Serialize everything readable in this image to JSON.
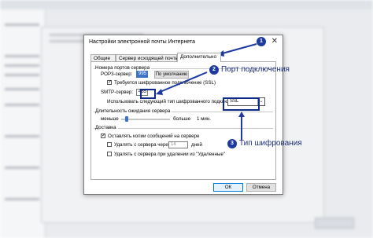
{
  "dialog": {
    "title": "Настройки электронной почты Интернета",
    "close_glyph": "✕",
    "tabs": [
      {
        "label": "Общие"
      },
      {
        "label": "Сервер исходящей почты"
      },
      {
        "label": "Дополнительно"
      }
    ],
    "ports": {
      "group_label": "Номера портов сервера",
      "pop3_label": "POP3-сервер:",
      "pop3_value": "995",
      "default_button": "По умолчанию",
      "ssl_checkbox_label": "Требуется шифрованное подключение (SSL)",
      "smtp_label": "SMTP-сервер:",
      "smtp_value": "465",
      "encryption_label": "Использовать следующий тип шифрованного подключения:",
      "encryption_value": "SSL"
    },
    "timeout": {
      "group_label": "Длительность ожидания сервера",
      "min_label": "меньше",
      "max_label": "больше",
      "value_label": "1 мин.",
      "level_fraction": 0.08
    },
    "delivery": {
      "group_label": "Доставка",
      "keep_copies_label": "Оставлять копии сообщений на сервере",
      "remove_after_label": "Удалять с сервера через",
      "remove_after_days": "14",
      "days_label": "дней",
      "remove_deleted_label": "Удалять с сервера при удалении из \"Удаленные\""
    },
    "ok_label": "ОК",
    "cancel_label": "Отмена"
  },
  "annotations": {
    "badge_1": "1",
    "badge_2": "2",
    "badge_3": "3",
    "callout_2": "Порт подключения",
    "callout_3": "Тип шифрования",
    "accent_color": "#1d3aa0"
  }
}
